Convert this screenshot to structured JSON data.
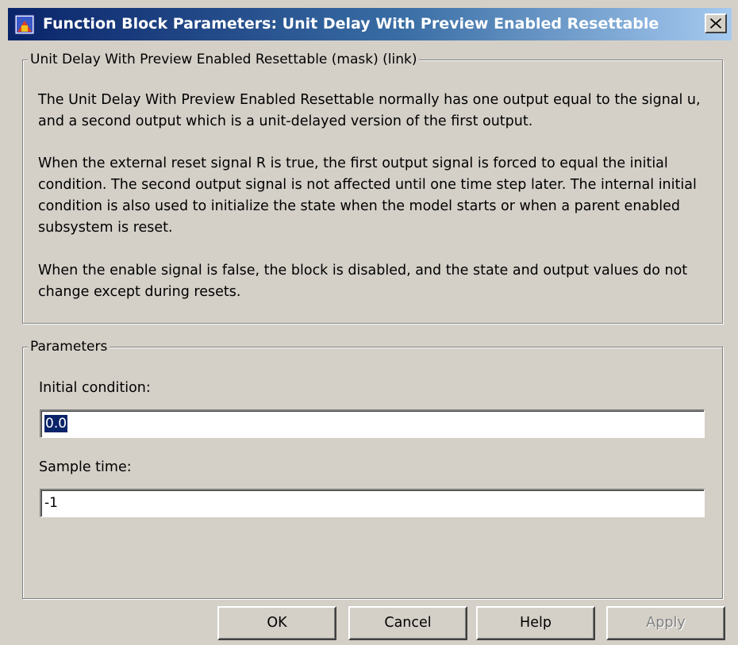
{
  "window": {
    "title": "Function Block Parameters: Unit Delay With Preview Enabled Resettable",
    "app_icon": "simulink-block-icon",
    "close_icon": "close-x-icon"
  },
  "description": {
    "legend": "Unit Delay With Preview Enabled Resettable (mask) (link)",
    "paragraphs": [
      "The Unit Delay With Preview Enabled Resettable normally has one output equal to the signal u, and a second output which is a unit-delayed version of the first output.",
      "When the external reset signal R is true, the first output signal is forced to equal the initial condition. The second output signal is not affected until one time step later. The internal initial condition is also used to initialize the state when the model starts or when a parent enabled subsystem is reset.",
      "When the enable signal is false, the block is disabled, and the state and output values do not change except during resets."
    ]
  },
  "parameters": {
    "legend": "Parameters",
    "initial_condition": {
      "label": "Initial condition:",
      "value": "0.0"
    },
    "sample_time": {
      "label": "Sample time:",
      "value": "-1"
    }
  },
  "buttons": {
    "ok": "OK",
    "cancel": "Cancel",
    "help": "Help",
    "apply": "Apply"
  }
}
